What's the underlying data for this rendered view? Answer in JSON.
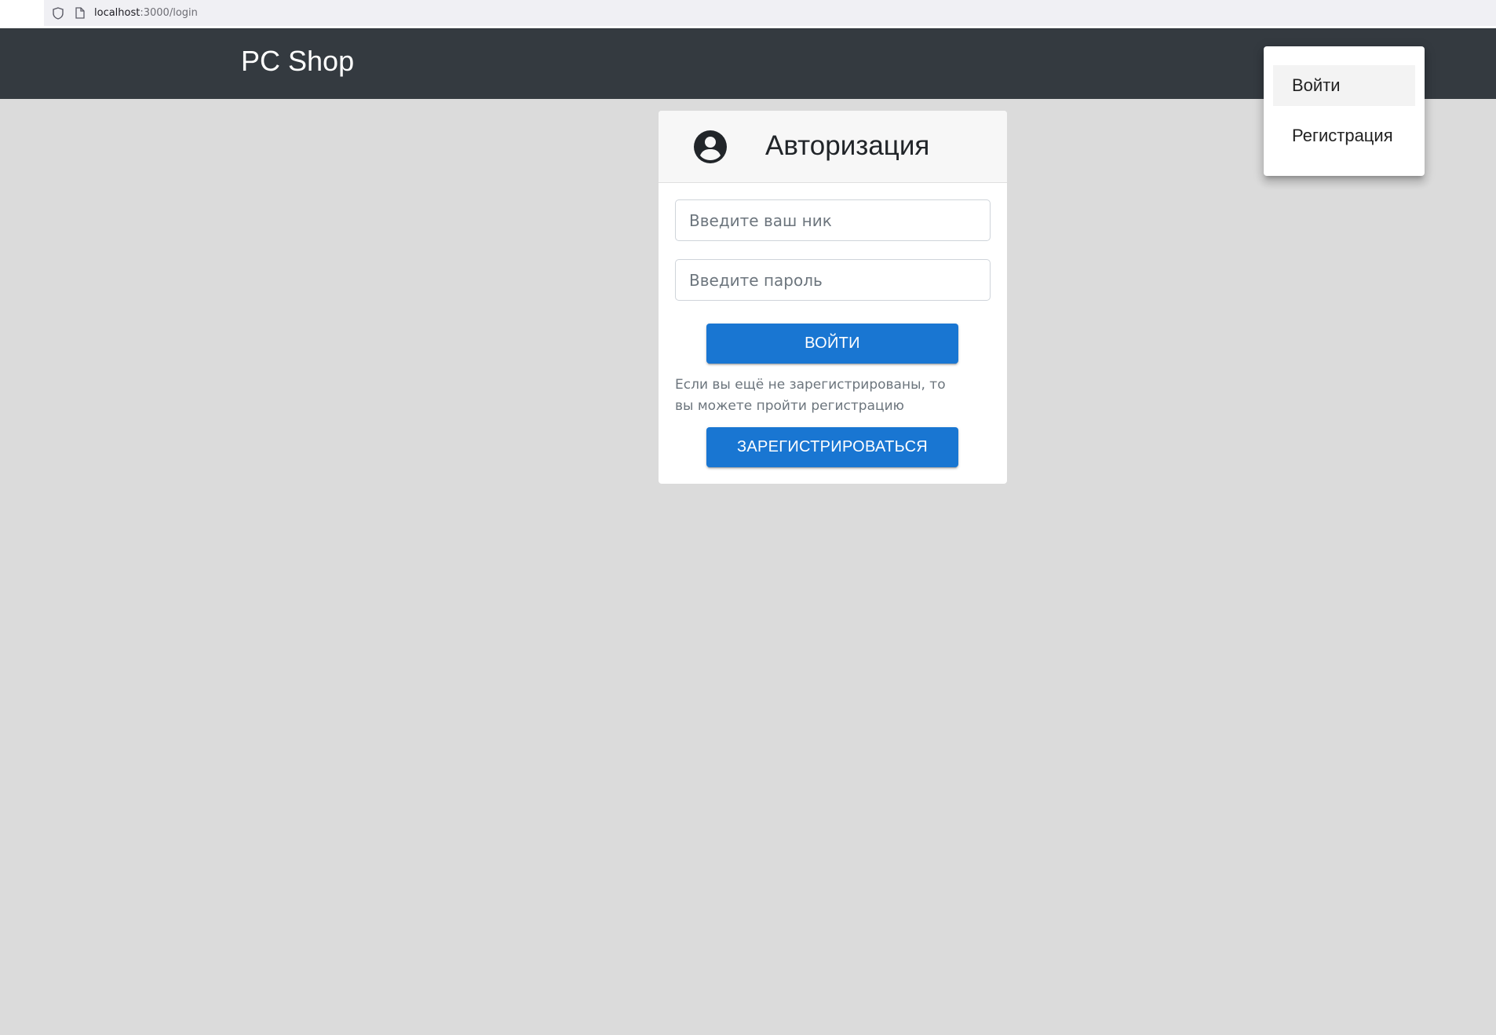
{
  "browser": {
    "url_host": "localhost",
    "url_path": ":3000/login"
  },
  "header": {
    "brand": "PC Shop"
  },
  "menu": {
    "items": [
      {
        "label": "Войти",
        "active": true
      },
      {
        "label": "Регистрация",
        "active": false
      }
    ]
  },
  "auth": {
    "title": "Авторизация",
    "icon": "account-circle-icon",
    "nick_placeholder": "Введите ваш ник",
    "password_placeholder": "Введите пароль",
    "login_button": "ВОЙТИ",
    "hint": "Если вы ещё не зарегистрированы, то вы можете пройти регистрацию",
    "register_button": "ЗАРЕГИСТРИРОВАТЬСЯ"
  },
  "colors": {
    "appbar": "#343a40",
    "primary": "#1976d2",
    "background": "#dbdbdb"
  }
}
